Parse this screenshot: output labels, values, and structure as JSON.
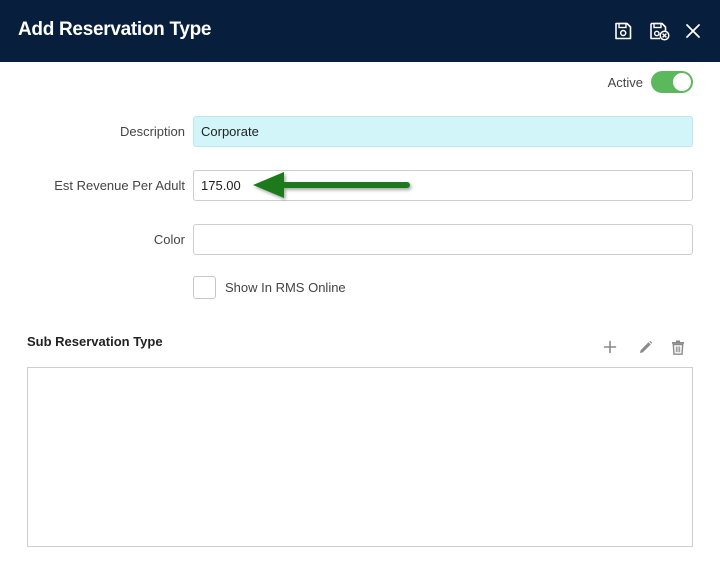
{
  "header": {
    "title": "Add Reservation Type",
    "save_icon": "save-icon",
    "save_close_icon": "save-and-close-icon",
    "close_icon": "close-icon",
    "background": "#071e3d"
  },
  "status": {
    "active_label": "Active",
    "active_on": true,
    "toggle_color": "#5cb85c"
  },
  "form": {
    "description_label": "Description",
    "description_value": "Corporate",
    "revenue_label": "Est Revenue Per Adult",
    "revenue_value": "175.00",
    "color_label": "Color",
    "color_value": "",
    "rms_online_label": "Show In RMS Online",
    "rms_online_checked": false,
    "highlight_color": "#d2f5fa"
  },
  "sub_types": {
    "title": "Sub Reservation Type",
    "add_icon": "plus-icon",
    "edit_icon": "pencil-icon",
    "delete_icon": "trash-icon",
    "rows": []
  },
  "annotation": {
    "arrow_icon": "arrow-left-icon",
    "arrow_color": "#1e7a1e"
  }
}
